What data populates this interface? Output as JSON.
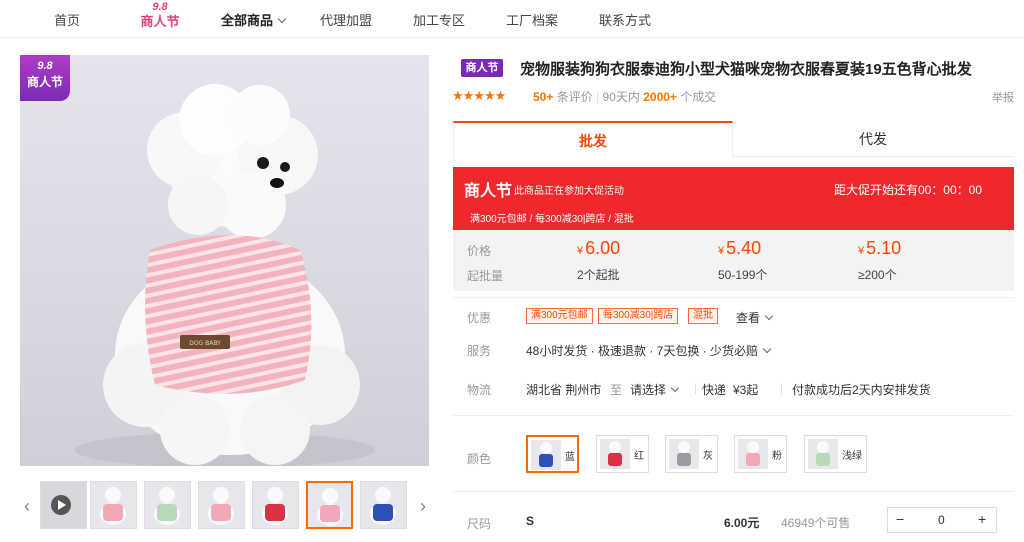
{
  "nav": {
    "items": [
      "首页",
      "全部商品",
      "代理加盟",
      "加工专区",
      "工厂档案",
      "联系方式"
    ],
    "badge_top": "9.8",
    "badge_bottom": "商人节"
  },
  "gallery": {
    "badge_top": "9.8",
    "badge_bottom": "商人节",
    "tag_text": "DOG BABY",
    "prev_icon": "chevron-left-icon",
    "next_icon": "chevron-right-icon"
  },
  "product": {
    "tag": "商人节",
    "title": "宠物服装狗狗衣服泰迪狗小型犬猫咪宠物衣服春夏装19五色背心批发",
    "stars": "★★★★★",
    "reviews": "50+",
    "reviews_label": "条评价",
    "period": "90天内",
    "sales": "2000+",
    "sales_label": "个成交",
    "report": "举报"
  },
  "tabs": [
    "批发",
    "代发"
  ],
  "promo": {
    "title": "商人节",
    "desc": "此商品正在参加大促活动",
    "countdown": "距大促开始还有00：00：00",
    "rules": "满300元包邮 / 每300减30|跨店 / 混批"
  },
  "price": {
    "price_label": "价格",
    "qty_label": "起批量",
    "currency": "¥",
    "tiers": [
      {
        "price": "6.00",
        "qty": "2个起批"
      },
      {
        "price": "5.40",
        "qty": "50-199个"
      },
      {
        "price": "5.10",
        "qty": "≥200个"
      }
    ]
  },
  "offers": {
    "label": "优惠",
    "coupons": [
      "满300元包邮",
      "每300减30|跨店",
      "混批"
    ],
    "see": "查看"
  },
  "service": {
    "label": "服务",
    "text": "48小时发货 · 极速退款 · 7天包换 · 少货必赔"
  },
  "logistics": {
    "label": "物流",
    "from": "湖北省 荆州市",
    "to_label": "至",
    "to": "请选择",
    "method": "快递",
    "fee": "¥3起",
    "note": "付款成功后2天内安排发货"
  },
  "colors": {
    "label": "颜色",
    "options": [
      "蓝",
      "红",
      "灰",
      "粉",
      "浅绿"
    ],
    "selected": "蓝",
    "dress_colors": [
      "#2e51b8",
      "#d63344",
      "#9a9aa0",
      "#f2a8b8",
      "#b8d9b8"
    ]
  },
  "size_row": {
    "label": "尺码",
    "size": "S",
    "price": "6.00元",
    "stock": "46949个可售",
    "quantity": "0",
    "minus": "−",
    "plus": "+"
  },
  "thumb_colors": [
    "#ffffff",
    "#f2a8b8",
    "#b8d9b8",
    "#f2a8b8",
    "#d63344",
    "#f2a8b8",
    "#2e51b8"
  ]
}
